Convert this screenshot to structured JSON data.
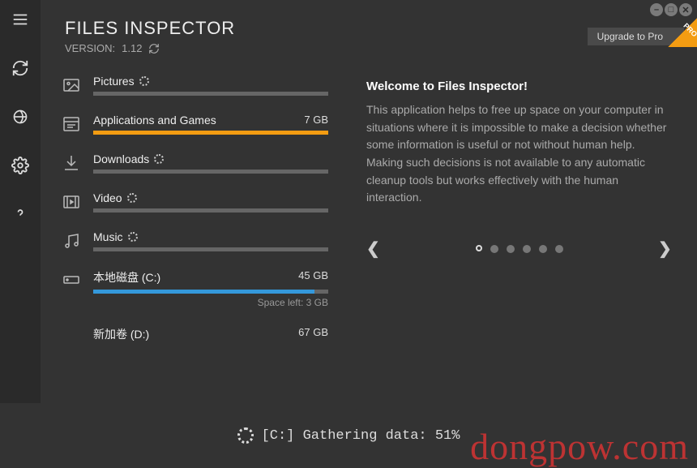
{
  "app": {
    "title": "FILES INSPECTOR",
    "version_prefix": "VERSION:",
    "version": "1.12"
  },
  "upgrade": {
    "label": "Upgrade to Pro",
    "ribbon": "PRO"
  },
  "window_controls": {
    "minimize": "–",
    "maximize": "□",
    "close": "✕"
  },
  "categories": [
    {
      "label": "Pictures",
      "size": "",
      "loading": true,
      "fill_percent": 0,
      "color": "gray"
    },
    {
      "label": "Applications and Games",
      "size": "7 GB",
      "loading": false,
      "fill_percent": 100,
      "color": "orange"
    },
    {
      "label": "Downloads",
      "size": "",
      "loading": true,
      "fill_percent": 0,
      "color": "gray"
    },
    {
      "label": "Video",
      "size": "",
      "loading": true,
      "fill_percent": 0,
      "color": "gray"
    },
    {
      "label": "Music",
      "size": "",
      "loading": true,
      "fill_percent": 0,
      "color": "gray"
    },
    {
      "label": "本地磁盘 (C:)",
      "size": "45 GB",
      "loading": false,
      "fill_percent": 94,
      "color": "blue",
      "sub": "Space left: 3 GB"
    },
    {
      "label": "新加卷 (D:)",
      "size": "67 GB",
      "loading": false,
      "fill_percent": null,
      "color": "none"
    }
  ],
  "welcome": {
    "title": "Welcome to Files Inspector!",
    "body": "This application helps to free up space on your computer in situations where it is impossible to make a decision whether some information is useful or not without human help. Making such decisions is not available to any automatic cleanup tools but works effectively with the human interaction."
  },
  "carousel": {
    "count": 6,
    "active_index": 0
  },
  "status": {
    "text": "[C:] Gathering data: 51%"
  },
  "watermark": "dongpow.com"
}
